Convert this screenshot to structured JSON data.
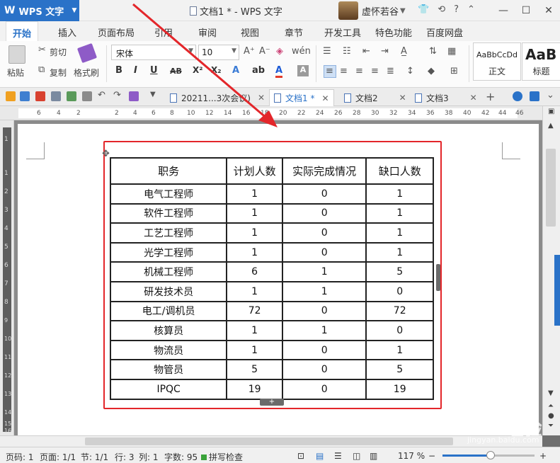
{
  "app": {
    "name": "WPS 文字",
    "window_title": "文档1 * - WPS 文字",
    "user": "虚怀若谷",
    "window_controls": [
      "minimize-icon",
      "maximize-icon",
      "close-icon"
    ],
    "accent_color": "#2a72c8"
  },
  "ribbon_tabs": [
    "开始",
    "插入",
    "页面布局",
    "引用",
    "审阅",
    "视图",
    "章节",
    "开发工具",
    "特色功能",
    "百度网盘"
  ],
  "toolbar": {
    "paste_label": "粘贴",
    "cut_label": "剪切",
    "copy_label": "复制",
    "format_painter_label": "格式刷",
    "font_name": "宋体",
    "font_size": "10",
    "style_samples": [
      {
        "sample": "AaBbCcDd",
        "name": "正文"
      },
      {
        "sample": "AaB",
        "name": "标题"
      }
    ]
  },
  "doc_tabs": [
    {
      "label": "20211...3次会议)",
      "active": false
    },
    {
      "label": "文档1 *",
      "active": true
    },
    {
      "label": "文档2",
      "active": false
    },
    {
      "label": "文档3",
      "active": false
    }
  ],
  "ruler": {
    "h_ticks": [
      "6",
      "4",
      "2",
      "2",
      "4",
      "6",
      "8",
      "10",
      "12",
      "14",
      "16",
      "18",
      "20",
      "22",
      "24",
      "26",
      "28",
      "30",
      "32",
      "34",
      "36",
      "38",
      "40",
      "42",
      "44",
      "46"
    ],
    "v_ticks": [
      "1",
      "1",
      "2",
      "3",
      "4",
      "5",
      "6",
      "7",
      "8",
      "9",
      "10",
      "11",
      "12",
      "13",
      "14",
      "15",
      "16"
    ]
  },
  "table": {
    "headers": [
      "职务",
      "计划人数",
      "实际完成情况",
      "缺口人数"
    ],
    "rows": [
      [
        "电气工程师",
        "1",
        "0",
        "1"
      ],
      [
        "软件工程师",
        "1",
        "0",
        "1"
      ],
      [
        "工艺工程师",
        "1",
        "0",
        "1"
      ],
      [
        "光学工程师",
        "1",
        "0",
        "1"
      ],
      [
        "机械工程师",
        "6",
        "1",
        "5"
      ],
      [
        "研发技术员",
        "1",
        "1",
        "0"
      ],
      [
        "电工/调机员",
        "72",
        "0",
        "72"
      ],
      [
        "核算员",
        "1",
        "1",
        "0"
      ],
      [
        "物流员",
        "1",
        "0",
        "1"
      ],
      [
        "物管员",
        "5",
        "0",
        "5"
      ],
      [
        "IPQC",
        "19",
        "0",
        "19"
      ]
    ]
  },
  "status_bar": {
    "page_code": "页码: 1",
    "pages": "页面: 1/1",
    "section": "节: 1/1",
    "line": "行: 3",
    "column": "列: 1",
    "word_count": "字数: 95",
    "spell_check": "拼写检查",
    "zoom": "117 %",
    "zoom_level": 0.52
  },
  "watermark": {
    "text": "Bai du 经验",
    "url": "jingyan.baidu.com"
  },
  "annotation_color": "#e3262a"
}
